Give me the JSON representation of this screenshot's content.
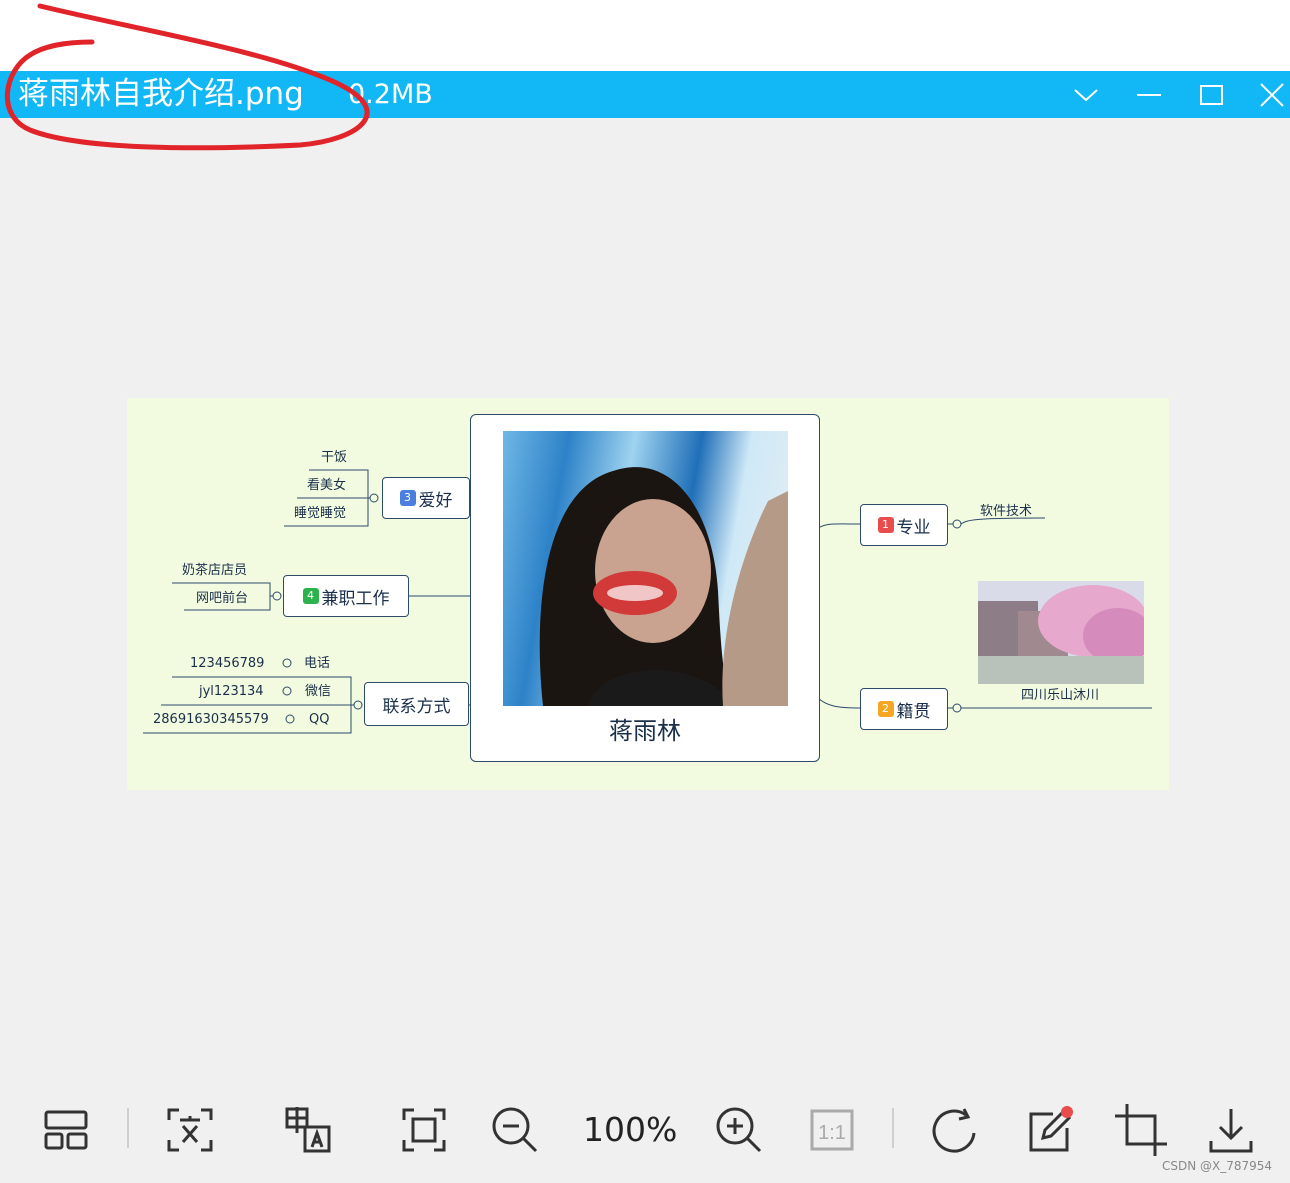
{
  "window": {
    "file_name": "蒋雨林自我介绍.png",
    "file_size": "0.2MB",
    "accent_color": "#12b7f5"
  },
  "mindmap": {
    "center": {
      "name": "蒋雨林"
    },
    "right": [
      {
        "badge": "1",
        "badge_color": "#e84c4c",
        "label": "专业",
        "children": [
          "软件技术"
        ]
      },
      {
        "badge": "2",
        "badge_color": "#f5a623",
        "label": "籍贯",
        "children": [
          "四川乐山沐川"
        ]
      }
    ],
    "left": [
      {
        "badge": "3",
        "badge_color": "#4a7fe0",
        "label": "爱好",
        "children": [
          "干饭",
          "看美女",
          "睡觉睡觉"
        ]
      },
      {
        "badge": "4",
        "badge_color": "#2bb24c",
        "label": "兼职工作",
        "children": [
          "奶茶店店员",
          "网吧前台"
        ]
      },
      {
        "label": "联系方式",
        "children": [
          {
            "value": "123456789",
            "type": "电话"
          },
          {
            "value": "jyl123134",
            "type": "微信"
          },
          {
            "value": "28691630345579",
            "type": "QQ"
          }
        ]
      }
    ]
  },
  "toolbar": {
    "zoom_level": "100%",
    "icons": [
      "layout-icon",
      "ocr-text-icon",
      "translate-icon",
      "fit-screen-icon",
      "zoom-out-icon",
      "zoom-in-icon",
      "actual-size-icon",
      "rotate-icon",
      "edit-icon",
      "crop-icon",
      "download-icon"
    ],
    "actual_size_label": "1:1"
  },
  "watermark": "CSDN @X_787954"
}
